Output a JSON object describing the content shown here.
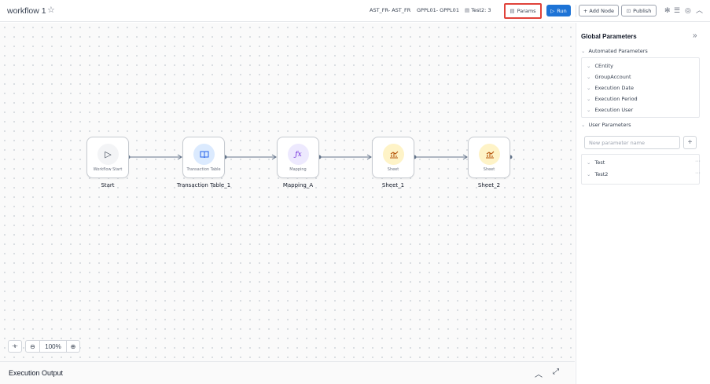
{
  "header": {
    "title": "workflow 1",
    "star_icon": "star-icon",
    "chips": [
      "AST_FR- AST_FR",
      "GPPL01- GPPL01",
      "Test2: 3"
    ],
    "params_label": "Params",
    "run_label": "Run",
    "add_node_label": "+ Add Node",
    "publish_label": "Publish"
  },
  "nodes": [
    {
      "type_label": "Workflow Start",
      "name": "Start",
      "icon": "play-icon",
      "circle_color": "#f3f4f6",
      "icon_color": "#374151",
      "glyph": "▷"
    },
    {
      "type_label": "Transaction Table",
      "name": "Transaction Table_1",
      "icon": "book-icon",
      "circle_color": "#dbeafe",
      "icon_color": "#2563eb",
      "glyph": "🕮"
    },
    {
      "type_label": "Mapping",
      "name": "Mapping_A",
      "icon": "function-icon",
      "circle_color": "#ede9fe",
      "icon_color": "#6d28d9",
      "glyph": "ƒx"
    },
    {
      "type_label": "Sheet",
      "name": "Sheet_1",
      "icon": "sheet-chart-icon",
      "circle_color": "#fef3c7",
      "icon_color": "#b45309",
      "glyph": "⫶"
    },
    {
      "type_label": "Sheet",
      "name": "Sheet_2",
      "icon": "sheet-chart-icon",
      "circle_color": "#fef3c7",
      "icon_color": "#b45309",
      "glyph": "⫶"
    }
  ],
  "zoom": {
    "level": "100%"
  },
  "execution": {
    "title": "Execution Output"
  },
  "panel": {
    "title": "Global Parameters",
    "automated_title": "Automated Parameters",
    "automated_items": [
      "CEntity",
      "GroupAccount",
      "Execution Date",
      "Execution Period",
      "Execution User"
    ],
    "user_title": "User Parameters",
    "new_param_placeholder": "New parameter name",
    "user_items": [
      "Test",
      "Test2"
    ]
  },
  "colors": {
    "accent": "#1d73d6",
    "highlight": "#e0423a"
  }
}
